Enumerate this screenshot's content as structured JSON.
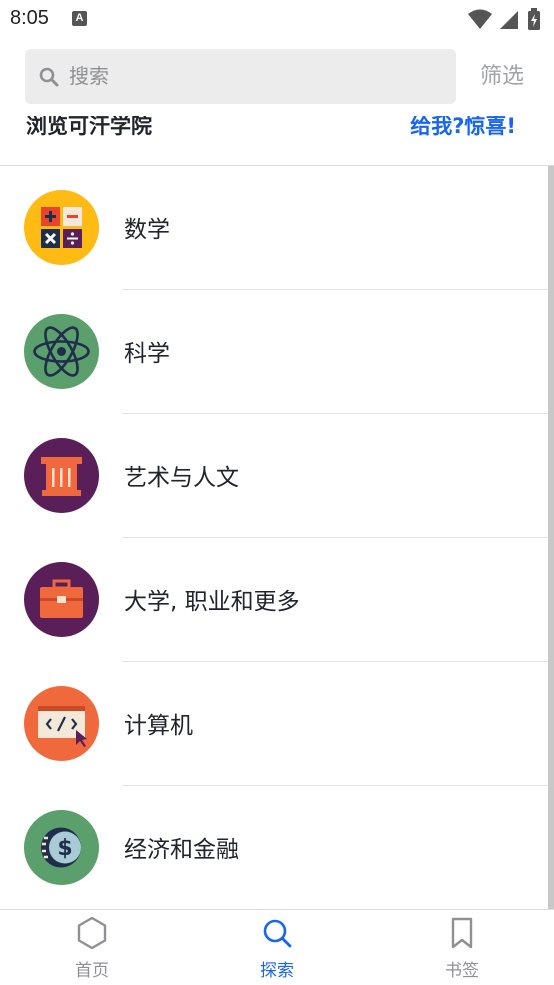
{
  "status_bar": {
    "time": "8:05",
    "notification_glyph": "A"
  },
  "search": {
    "placeholder": "搜索",
    "value": ""
  },
  "filter_label": "筛选",
  "peek_row": {
    "title": "浏览可汗学院",
    "link": "给我?惊喜!"
  },
  "subjects": [
    {
      "label": "数学",
      "icon": "calculator-icon",
      "color": "#fdbb13"
    },
    {
      "label": "科学",
      "icon": "atom-icon",
      "color": "#5b9f6d"
    },
    {
      "label": "艺术与人文",
      "icon": "column-icon",
      "color": "#5a1f59"
    },
    {
      "label": "大学, 职业和更多",
      "icon": "toolbox-icon",
      "color": "#5a1f59"
    },
    {
      "label": "计算机",
      "icon": "code-window-icon",
      "color": "#f0693c"
    },
    {
      "label": "经济和金融",
      "icon": "coin-icon",
      "color": "#5b9f6d"
    }
  ],
  "bottom_nav": [
    {
      "label": "首页",
      "icon": "hexagon-icon",
      "active": false
    },
    {
      "label": "探索",
      "icon": "search-icon",
      "active": true
    },
    {
      "label": "书签",
      "icon": "bookmark-icon",
      "active": false
    }
  ],
  "colors": {
    "accent": "#1865f2",
    "inactive": "#8f9094"
  }
}
